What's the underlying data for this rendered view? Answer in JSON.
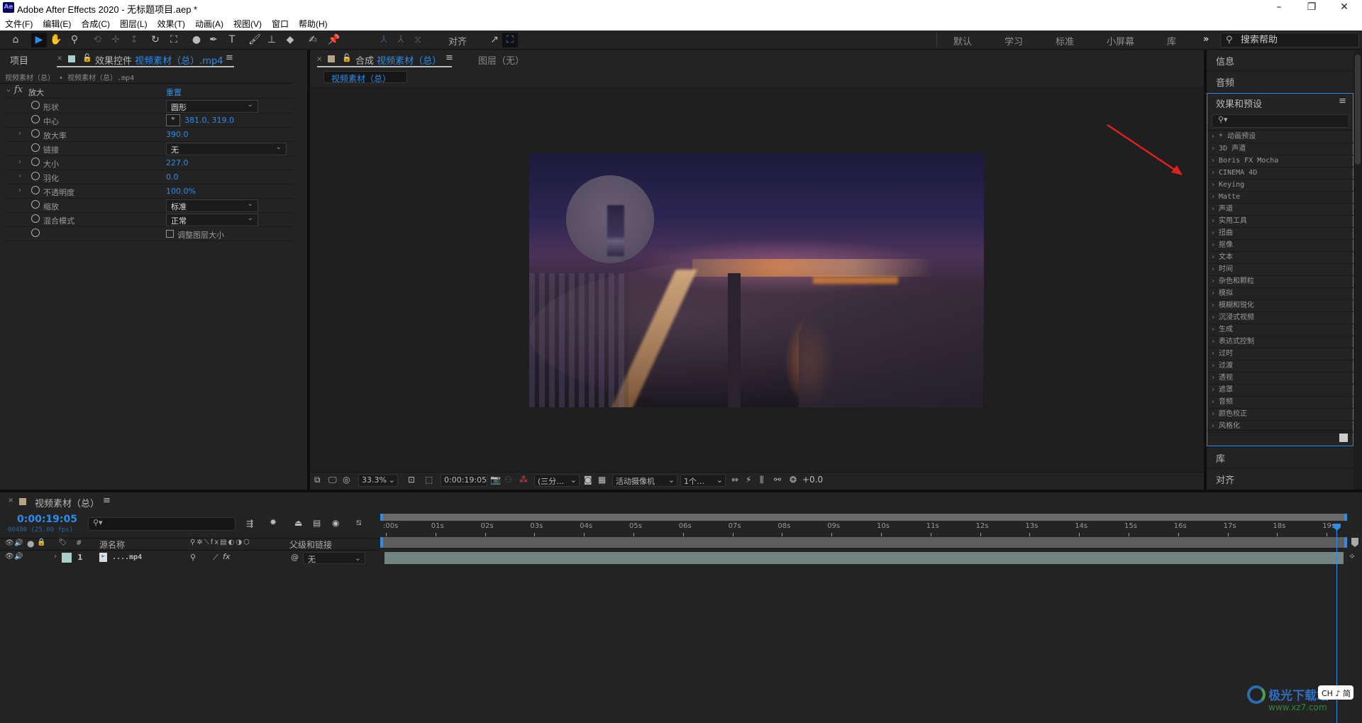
{
  "window": {
    "app_icon": "Ae",
    "title": "Adobe After Effects 2020 - 无标题项目.aep *",
    "controls": {
      "minimize": "–",
      "restore": "❐",
      "close": "✕"
    }
  },
  "menu": [
    "文件(F)",
    "编辑(E)",
    "合成(C)",
    "图层(L)",
    "效果(T)",
    "动画(A)",
    "视图(V)",
    "窗口",
    "帮助(H)"
  ],
  "toolbar": {
    "align_label": "对齐",
    "workspaces": [
      "默认",
      "学习",
      "标准",
      "小屏幕",
      "库"
    ],
    "more": "»",
    "help_search_placeholder": "搜索帮助"
  },
  "project_tab": "项目",
  "effect_controls": {
    "tab_prefix": "效果控件",
    "tab_target": "视频素材（总）.mp4",
    "breadcrumb": "视频素材（总） • 视频素材（总）.mp4",
    "effect_name": "放大",
    "fx": "fx",
    "reset": "重置",
    "props": [
      {
        "label": "形状",
        "type": "dropdown",
        "value": "圆形"
      },
      {
        "label": "中心",
        "type": "point",
        "value": "381.0, 319.0"
      },
      {
        "label": "放大率",
        "type": "number",
        "value": "390.0",
        "expandable": true
      },
      {
        "label": "链接",
        "type": "dropdown",
        "value": "无"
      },
      {
        "label": "大小",
        "type": "number",
        "value": "227.0",
        "expandable": true
      },
      {
        "label": "羽化",
        "type": "number",
        "value": "0.0",
        "expandable": true
      },
      {
        "label": "不透明度",
        "type": "number",
        "value": "100.0%",
        "expandable": true
      },
      {
        "label": "缩放",
        "type": "dropdown",
        "value": "标准"
      },
      {
        "label": "混合模式",
        "type": "dropdown",
        "value": "正常"
      },
      {
        "label": "",
        "type": "checkbox",
        "value": "调整图层大小",
        "checked": false
      }
    ]
  },
  "composition": {
    "tab_prefix": "合成",
    "tab_name": "视频素材（总）",
    "layer_tab": "图层（无）",
    "subtab": "视频素材（总）",
    "viewer_toolbar": {
      "zoom": "33.3%",
      "timecode": "0:00:19:05",
      "resolution": "(三分…",
      "camera": "活动摄像机",
      "views": "1个…",
      "exposure": "+0.0"
    }
  },
  "right_panels": {
    "info": "信息",
    "audio": "音频",
    "effects_presets": {
      "title": "效果和预设",
      "search_placeholder": "",
      "items": [
        "* 动画预设",
        "3D 声道",
        "Boris FX Mocha",
        "CINEMA 4D",
        "Keying",
        "Matte",
        "声道",
        "实用工具",
        "扭曲",
        "抠像",
        "文本",
        "时间",
        "杂色和颗粒",
        "模拟",
        "模糊和锐化",
        "沉浸式视频",
        "生成",
        "表达式控制",
        "过时",
        "过渡",
        "透视",
        "遮罩",
        "音频",
        "颜色校正",
        "风格化"
      ]
    },
    "library": "库",
    "align": "对齐"
  },
  "timeline": {
    "comp_name": "视频素材（总）",
    "timecode": "0:00:19:05",
    "frame_info": "00480 (25.00 fps)",
    "columns": {
      "number": "#",
      "source_name": "源名称",
      "parent": "父级和链接"
    },
    "ruler": [
      ":00s",
      "01s",
      "02s",
      "03s",
      "04s",
      "05s",
      "06s",
      "07s",
      "08s",
      "09s",
      "10s",
      "11s",
      "12s",
      "13s",
      "14s",
      "15s",
      "16s",
      "17s",
      "18s",
      "19s"
    ],
    "playhead_seconds": 19.2,
    "layers": [
      {
        "index": "1",
        "name": "....mp4",
        "parent": "无",
        "label_color": "#a8cfcc"
      }
    ]
  },
  "colors": {
    "accent": "#2d8ceb",
    "label_comp": "#b5a585",
    "label_layer": "#a8cfcc",
    "layer_bar": "#738582"
  },
  "watermark": {
    "site": "极光下载站",
    "url": "www.xz7.com",
    "ime": "CH ♪ 简"
  }
}
